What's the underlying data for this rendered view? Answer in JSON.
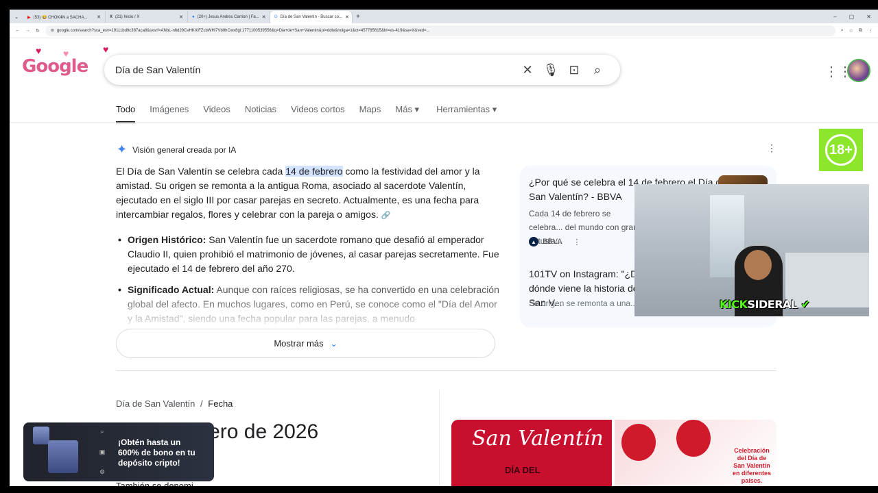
{
  "browser": {
    "tabs": [
      {
        "label": "(53) 😂 CHOK4N a SACHA...",
        "icon": "youtube-icon"
      },
      {
        "label": "(21) Inicio / X",
        "icon": "x-icon"
      },
      {
        "label": "(20+) Jesus Andres Carrion | Fa...",
        "icon": "facebook-icon"
      },
      {
        "label": "Día de San Valentín - Buscar co...",
        "icon": "google-icon"
      }
    ],
    "url": "google.com/search?sca_esv=19111bd9c387aca8&sxsrf=ANbL-n6d29CvHKXlFZcbWHi7Vb9hCwx8gi:1771100539556&q=Dia+de+San+Valentin&oi=ddle&noiga=1&ct=457785615&hl=es-419&sa=X&ved=..."
  },
  "search": {
    "query": "Día de San Valentín"
  },
  "nav": {
    "tabs": [
      "Todo",
      "Imágenes",
      "Videos",
      "Noticias",
      "Videos cortos",
      "Maps",
      "Más ▾",
      "Herramientas ▾"
    ]
  },
  "ai_overview": {
    "heading": "Visión general creada por IA",
    "p_before": "El Día de San Valentín se celebra cada ",
    "p_highlight": "14 de febrero",
    "p_after": " como la festividad del amor y la amistad. Su origen se remonta a la antigua Roma, asociado al sacerdote Valentín, ejecutado en el siglo III por casar parejas en secreto. Actualmente, es una fecha para intercambiar regalos, flores y celebrar con la pareja o amigos.",
    "bullets": [
      {
        "title": "Origen Histórico:",
        "text": " San Valentín fue un sacerdote romano que desafió al emperador Claudio II, quien prohibió el matrimonio de jóvenes, al casar parejas secretamente. Fue ejecutado el 14 de febrero del año 270."
      },
      {
        "title": "Significado Actual:",
        "text": " Aunque con raíces religiosas, se ha convertido en una celebración global del afecto. En muchos lugares, como en Perú, se conoce como el \"Día del Amor y la Amistad\", siendo una fecha popular para las parejas, a menudo"
      }
    ],
    "show_more": "Mostrar más"
  },
  "sources": {
    "card1_title": "¿Por qué se celebra el 14 de febrero el Día de San Valentín? - BBVA",
    "card1_desc": "Cada 14 de febrero se celebra... del mundo con gran entusia...",
    "card1_source": "BBVA",
    "card2_title": "101TV on Instagram: \"¿De dónde viene la historia de San V...",
    "card2_desc": "Su origen se remonta a una..."
  },
  "overlay": {
    "age_badge": "18+",
    "streamer_prefix": "KICK",
    "streamer_name": "SIDERAL"
  },
  "knowledge": {
    "breadcrumb_root": "Día de San Valentín",
    "breadcrumb_sep": "/",
    "breadcrumb_current": "Fecha",
    "date": "14 de febrero de 2026",
    "image1_title": "San Valentín",
    "image1_sub": "DÍA DEL",
    "image2_caption": "Celebración del Día de San Valentín en diferentes países.",
    "also_label": "También se denomi..."
  },
  "ad": {
    "message": "¡Obtén hasta un 600% de bono en tu depósito cripto!"
  }
}
